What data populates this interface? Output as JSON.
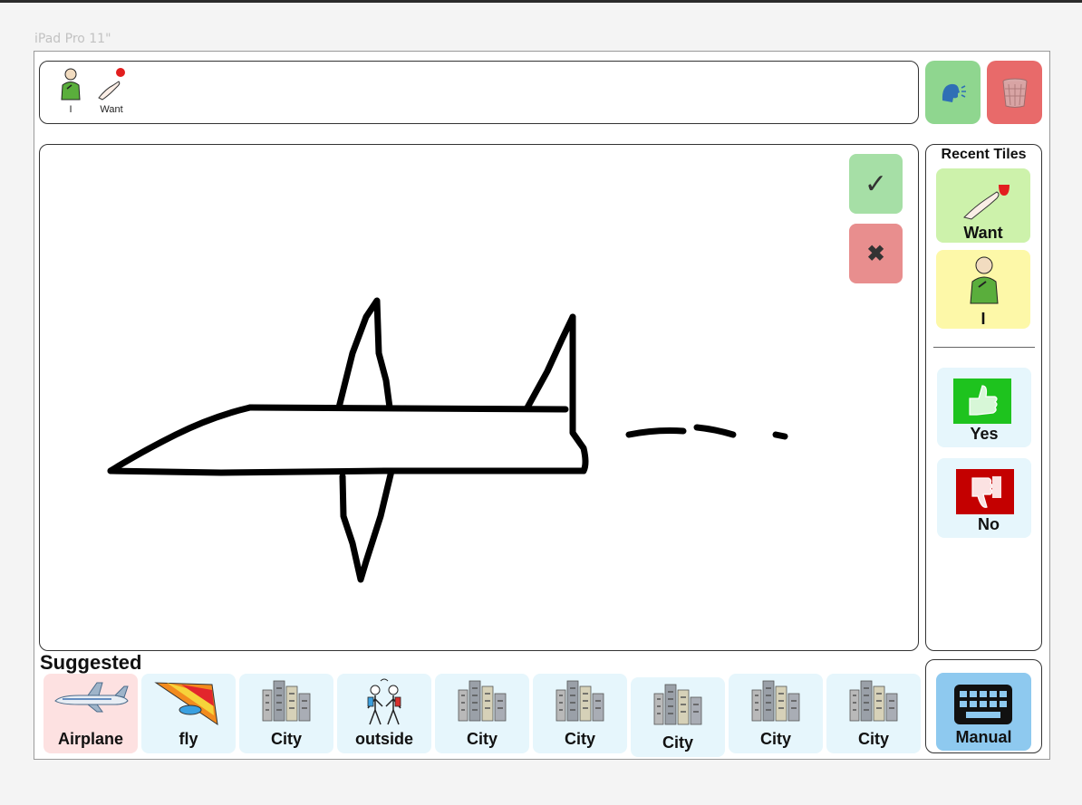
{
  "device_label": "iPad Pro 11\"",
  "sentence": {
    "words": [
      {
        "label": "I",
        "icon": "person-pointing-self-icon"
      },
      {
        "label": "Want",
        "icon": "hand-want-icon"
      }
    ]
  },
  "actions": {
    "speak_icon": "speaking-head-icon",
    "clear_icon": "trash-bin-icon"
  },
  "canvas": {
    "confirm_symbol": "✓",
    "cancel_symbol": "✖"
  },
  "recent": {
    "title": "Recent Tiles",
    "tiles": [
      {
        "label": "Want",
        "color": "#cdf2ab"
      },
      {
        "label": "I",
        "color": "#fdf8a8"
      }
    ],
    "quick": [
      {
        "label": "Yes",
        "color": "#e6f6fc"
      },
      {
        "label": "No",
        "color": "#e6f6fc"
      }
    ]
  },
  "suggested": {
    "title": "Suggested",
    "tiles": [
      {
        "label": "Airplane",
        "icon": "airplane-icon",
        "color": "#fde1e1"
      },
      {
        "label": "fly",
        "icon": "hang-glider-icon",
        "color": "#e6f6fc"
      },
      {
        "label": "City",
        "icon": "city-buildings-icon",
        "color": "#e6f6fc"
      },
      {
        "label": "outside",
        "icon": "people-outside-icon",
        "color": "#e6f6fc"
      },
      {
        "label": "City",
        "icon": "city-buildings-icon",
        "color": "#e6f6fc"
      },
      {
        "label": "City",
        "icon": "city-buildings-icon",
        "color": "#e6f6fc"
      },
      {
        "label": "City",
        "icon": "city-buildings-icon",
        "color": "#e6f6fc"
      },
      {
        "label": "City",
        "icon": "city-buildings-icon",
        "color": "#e6f6fc"
      },
      {
        "label": "City",
        "icon": "city-buildings-icon",
        "color": "#e6f6fc"
      }
    ]
  },
  "manual": {
    "label": "Manual",
    "icon": "keyboard-icon",
    "color": "#8ec9ef"
  }
}
